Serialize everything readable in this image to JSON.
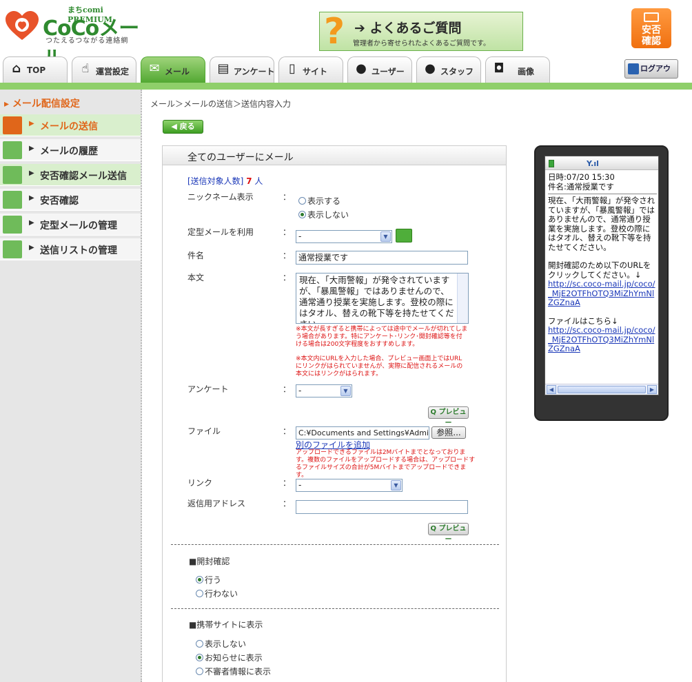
{
  "header": {
    "premium_label": "まちcomi PREMIUM",
    "brand": "CoCoメール",
    "tagline": "つたえるつながる連絡網",
    "faq_title": "よくあるご質問",
    "faq_subtitle": "管理者から寄せられたよくあるご質問です。",
    "safety_label": "安否確認",
    "logout_label": "ログアウト"
  },
  "nav": {
    "tabs": [
      {
        "label": "TOP",
        "icon": "home-icon"
      },
      {
        "label": "運営設定",
        "icon": "hand-icon"
      },
      {
        "label": "メール",
        "icon": "mail-icon",
        "active": true
      },
      {
        "label": "アンケート",
        "icon": "document-icon"
      },
      {
        "label": "サイト",
        "icon": "mobile-icon"
      },
      {
        "label": "ユーザー",
        "icon": "user-icon"
      },
      {
        "label": "スタッフ",
        "icon": "staff-icon"
      },
      {
        "label": "画像",
        "icon": "camera-icon"
      }
    ]
  },
  "sidebar": {
    "title": "メール配信設定",
    "items": [
      {
        "label": "メールの送信",
        "icon": "mail-send-icon",
        "active": true
      },
      {
        "label": "メールの履歴",
        "icon": "mail-history-icon"
      },
      {
        "label": "安否確認メール送信",
        "icon": "safety-mail-icon"
      },
      {
        "label": "安否確認",
        "icon": "safety-person-icon"
      },
      {
        "label": "定型メールの管理",
        "icon": "template-icon"
      },
      {
        "label": "送信リストの管理",
        "icon": "list-icon"
      }
    ]
  },
  "breadcrumb": "メール＞メールの送信＞送信内容入力",
  "back_label": "戻る",
  "form": {
    "title": "全てのユーザーにメール",
    "recipients_label": "[送信対象人数]",
    "recipients_count": "7",
    "recipients_unit": "人",
    "nickname_label": "ニックネーム表示",
    "nickname_show": "表示する",
    "nickname_hide": "表示しない",
    "template_label": "定型メールを利用",
    "template_value": "-",
    "subject_label": "件名",
    "subject_value": "通常授業です",
    "body_label": "本文",
    "body_value": "現在、「大雨警報」が発令されていますが、「暴風警報」ではありませんので、通常通り授業を実施します。登校の際にはタオル、替えの靴下等を持たせてください。",
    "body_note_1": "※本文が長すぎると携帯によっては途中でメールが切れてしまう場合があります。特にアンケート･リンク･開封確認等を付ける場合は200文字程度をおすすめします。",
    "body_note_2": "※本文内にURLを入力した場合、プレビュー画面上ではURLにリンクがはられていませんが、実際に配信されるメールの本文にはリンクがはられます。",
    "survey_label": "アンケート",
    "survey_value": "-",
    "preview_label": "プレビュー",
    "file_label": "ファイル",
    "file_value": "C:¥Documents and Settings¥Admi",
    "browse_label": "参照...",
    "add_file_label": "別のファイルを追加",
    "file_note": "アップロードできるファイルは2Mバイトまでとなっております。複数のファイルをアップロードする場合は、アップロードするファイルサイズの合計が5Mバイトまでアップロードできます。",
    "link_label": "リンク",
    "link_value": "-",
    "reply_label": "返信用アドレス",
    "reply_value": "",
    "colon": "：",
    "open_check_title": "■開封確認",
    "open_check_yes": "行う",
    "open_check_no": "行わない",
    "mobile_site_title": "■携帯サイトに表示",
    "mobile_site_none": "表示しない",
    "mobile_site_news": "お知らせに表示",
    "mobile_site_suspicious": "不審者情報に表示"
  },
  "phone": {
    "datetime": "日時:07/20 15:30",
    "subject": "件名:通常授業です",
    "body": "現在、「大雨警報」が発令されていますが、「暴風警報」ではありませんので、通常通り授業を実施します。登校の際にはタオル、替えの靴下等を持たせてください。",
    "open_check_text": "開封確認のため以下のURLをクリックしてください。↓",
    "url1": "http://sc.coco-mail.jp/coco/_MjE2OTFhOTQ3MiZhYmNlZGZnaA",
    "file_text": "ファイルはこちら↓",
    "url2": "http://sc.coco-mail.jp/coco/_MjE2OTFhOTQ3MiZhYmNlZGZnaA"
  },
  "colors": {
    "accent_green": "#52a832",
    "accent_orange": "#e0661a",
    "note_red": "#dd1111",
    "link_blue": "#1a37b8"
  }
}
